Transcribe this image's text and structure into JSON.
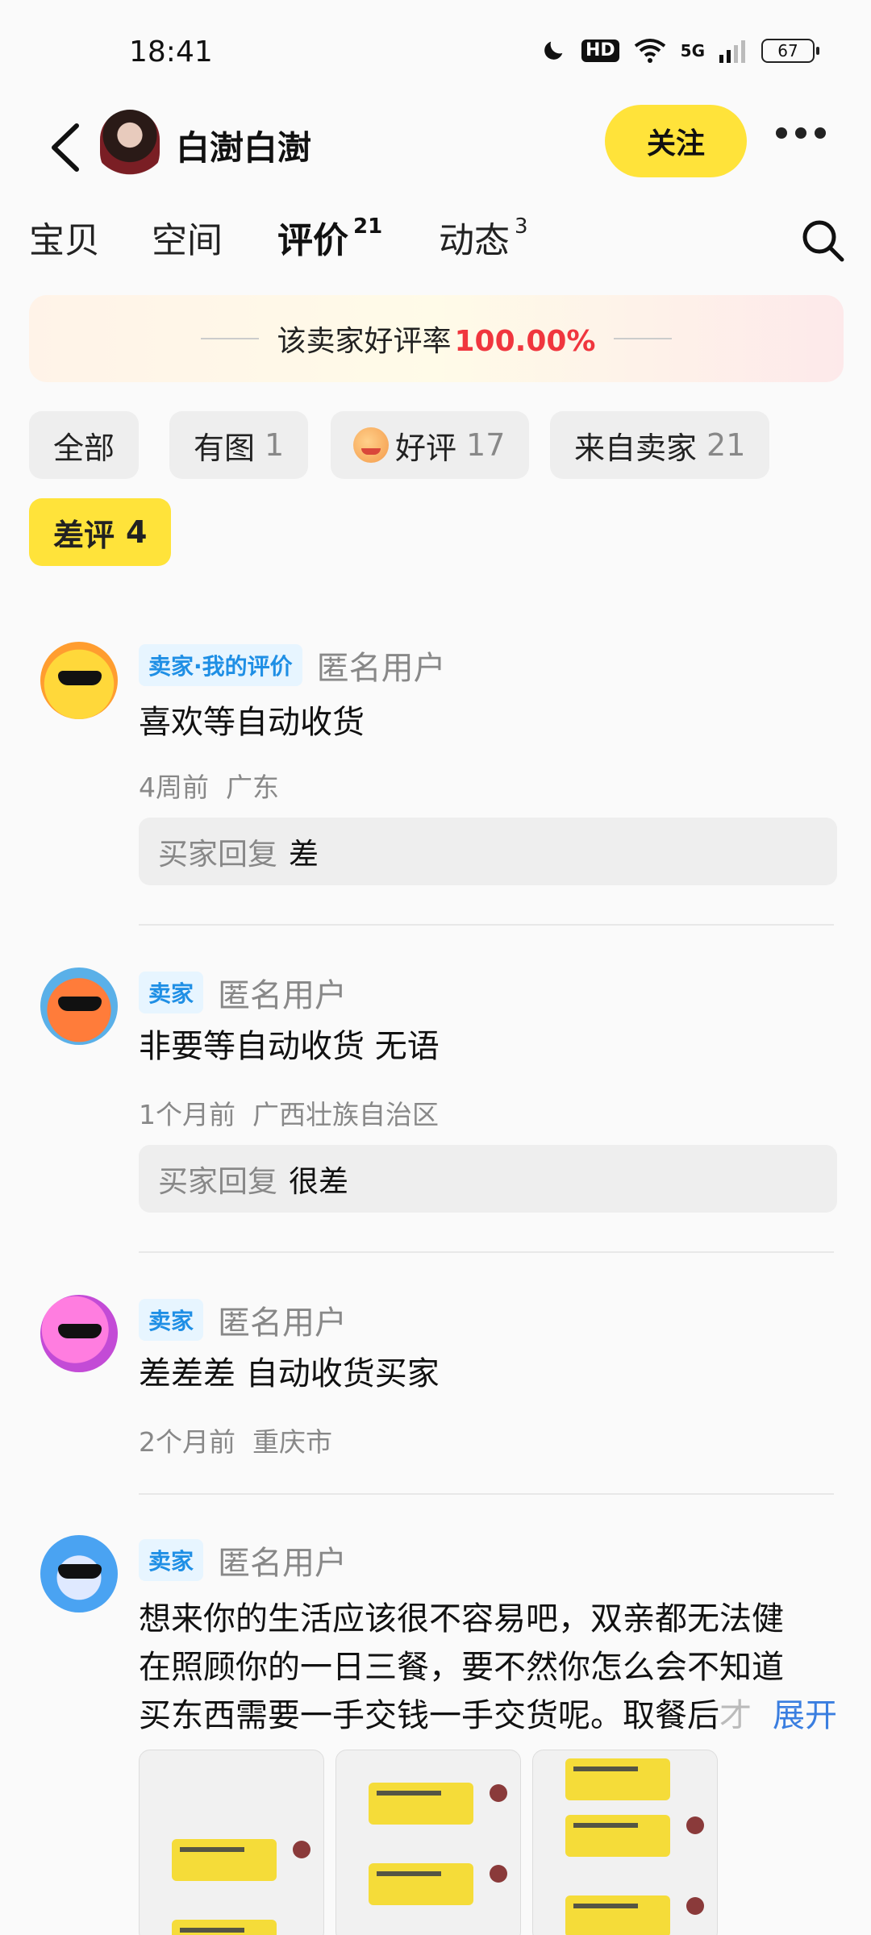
{
  "status": {
    "time": "18:41",
    "hd": "HD",
    "signal": "5G",
    "battery": "67"
  },
  "header": {
    "shop_name": "白澍白澍",
    "follow_label": "关注"
  },
  "tabs": [
    {
      "label": "宝贝",
      "count": ""
    },
    {
      "label": "空间",
      "count": ""
    },
    {
      "label": "评价",
      "count": "21"
    },
    {
      "label": "动态",
      "count": "3"
    }
  ],
  "rate": {
    "label": "该卖家好评率",
    "value": "100.00%"
  },
  "filters": [
    {
      "label": "全部",
      "count": ""
    },
    {
      "label": "有图",
      "count": "1"
    },
    {
      "label": "好评",
      "count": "17"
    },
    {
      "label": "来自卖家",
      "count": "21"
    },
    {
      "label": "差评",
      "count": "4"
    }
  ],
  "reviews": [
    {
      "badge": "卖家·我的评价",
      "user": "匿名用户",
      "content": "喜欢等自动收货",
      "time": "4周前",
      "location": "广东",
      "reply_label": "买家回复",
      "reply": "差"
    },
    {
      "badge": "卖家",
      "user": "匿名用户",
      "content": "非要等自动收货 无语",
      "time": "1个月前",
      "location": "广西壮族自治区",
      "reply_label": "买家回复",
      "reply": "很差"
    },
    {
      "badge": "卖家",
      "user": "匿名用户",
      "content": "差差差 自动收货买家",
      "time": "2个月前",
      "location": "重庆市"
    },
    {
      "badge": "卖家",
      "user": "匿名用户",
      "content_line1": "想来你的生活应该很不容易吧，双亲都无法健",
      "content_line2": "在照顾你的一日三餐，要不然你怎么会不知道",
      "content_line3": "买东西需要一手交钱一手交货呢。取餐后",
      "content_fade": "才",
      "expand": "展开"
    }
  ],
  "colors": {
    "accent": "#ffe33a",
    "rate": "#f0363e",
    "badge_text": "#1f8fe5",
    "link": "#3a7ee0"
  }
}
